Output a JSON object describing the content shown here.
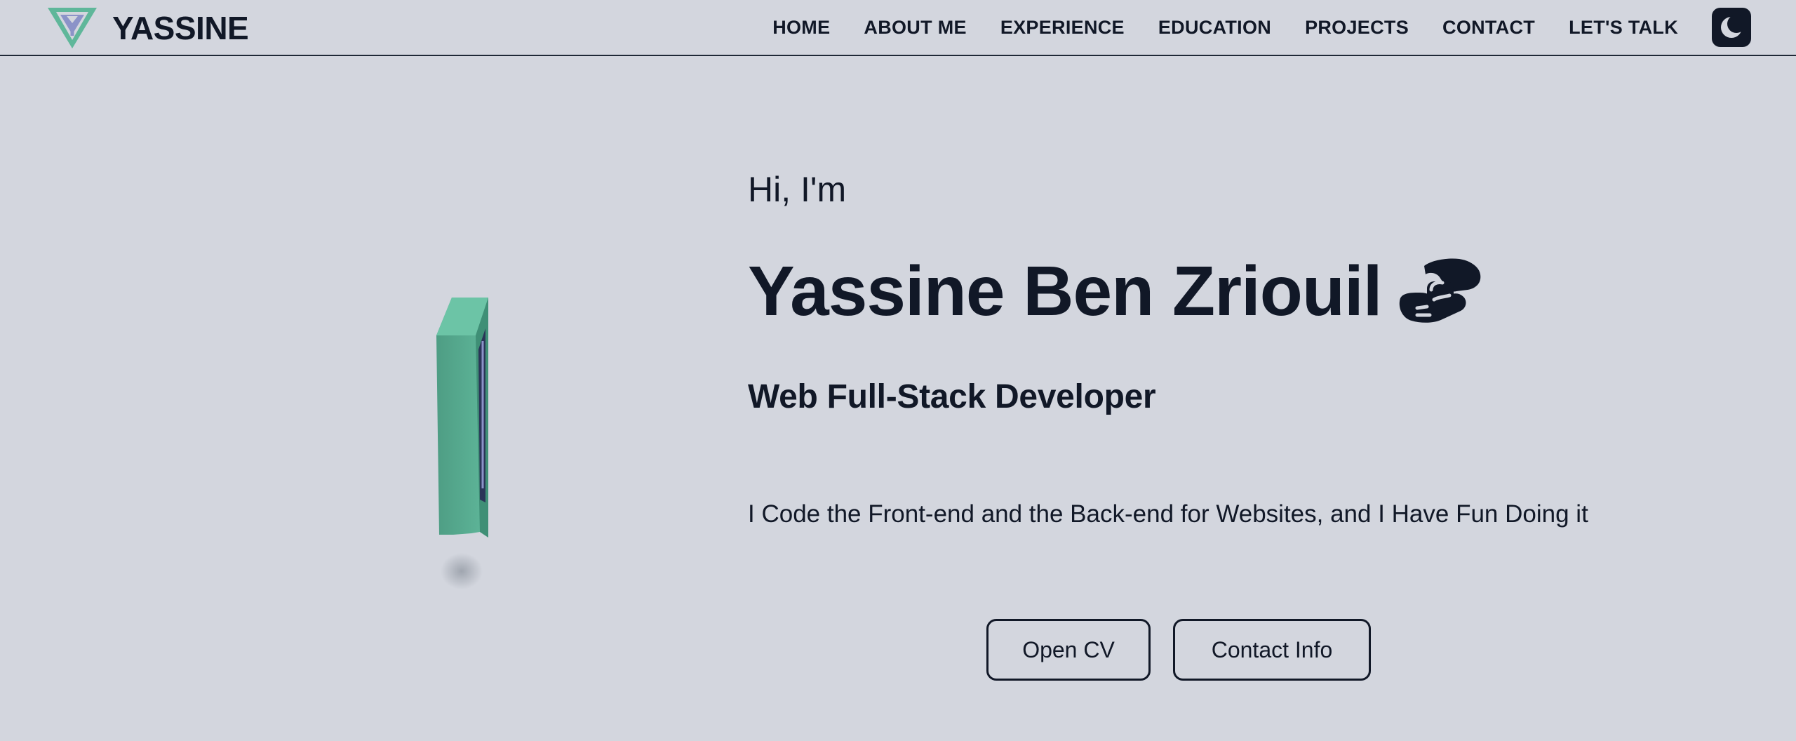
{
  "brand": {
    "name": "YASSINE",
    "logo_icon": "triangle-y-logo-icon",
    "colors": {
      "outer": "#5fb79a",
      "inner": "#8b93c8"
    }
  },
  "nav": {
    "items": [
      {
        "label": "HOME"
      },
      {
        "label": "ABOUT ME"
      },
      {
        "label": "EXPERIENCE"
      },
      {
        "label": "EDUCATION"
      },
      {
        "label": "PROJECTS"
      },
      {
        "label": "CONTACT"
      },
      {
        "label": "LET'S TALK"
      }
    ],
    "theme_toggle_icon": "moon-icon"
  },
  "hero": {
    "greeting": "Hi, I'm",
    "name": "Yassine Ben Zriouil",
    "name_icon": "handshake-icon",
    "role": "Web Full-Stack Developer",
    "tagline": "I Code the Front-end and the Back-end for Websites, and I Have Fun Doing it",
    "visual_icon": "3d-logo-model-icon",
    "buttons": {
      "cv_label": "Open CV",
      "contact_label": "Contact Info"
    }
  },
  "colors": {
    "background": "#d3d6de",
    "text": "#111827",
    "accent_green": "#5fb79a"
  }
}
